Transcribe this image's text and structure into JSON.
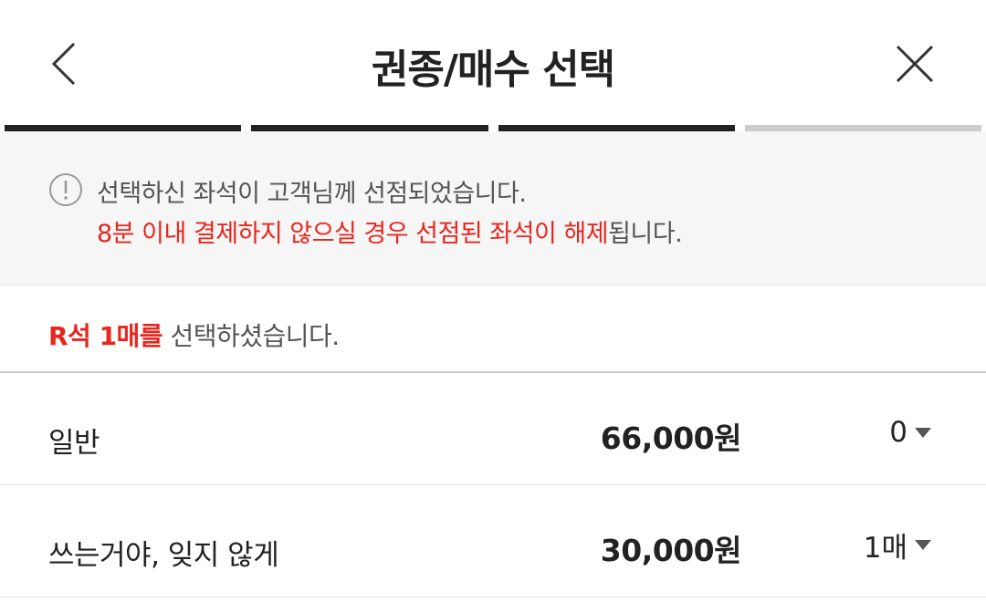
{
  "header": {
    "title": "권종/매수 선택",
    "back_icon": "chevron-left-icon",
    "close_icon": "close-icon"
  },
  "progress": {
    "total_steps": 4,
    "completed_steps": 3
  },
  "notice": {
    "icon": "info-circle-icon",
    "line1": "선택하신 좌석이 고객님께 선점되었습니다.",
    "line2_highlight": "8분 이내 결제하지 않으실 경우 선점된 좌석이 해제",
    "line2_rest": "됩니다."
  },
  "selection": {
    "highlight": "R석 1매를",
    "rest": " 선택하셨습니다."
  },
  "tickets": [
    {
      "name": "일반",
      "price": "66,000원",
      "quantity": "0"
    },
    {
      "name": "쓰는거야, 잊지 않게",
      "price": "30,000원",
      "quantity": "1매"
    }
  ],
  "colors": {
    "accent_red": "#e8261d",
    "text_dark": "#222222",
    "notice_bg": "#f6f6f7",
    "progress_done": "#222222",
    "progress_pending": "#cccccc"
  }
}
